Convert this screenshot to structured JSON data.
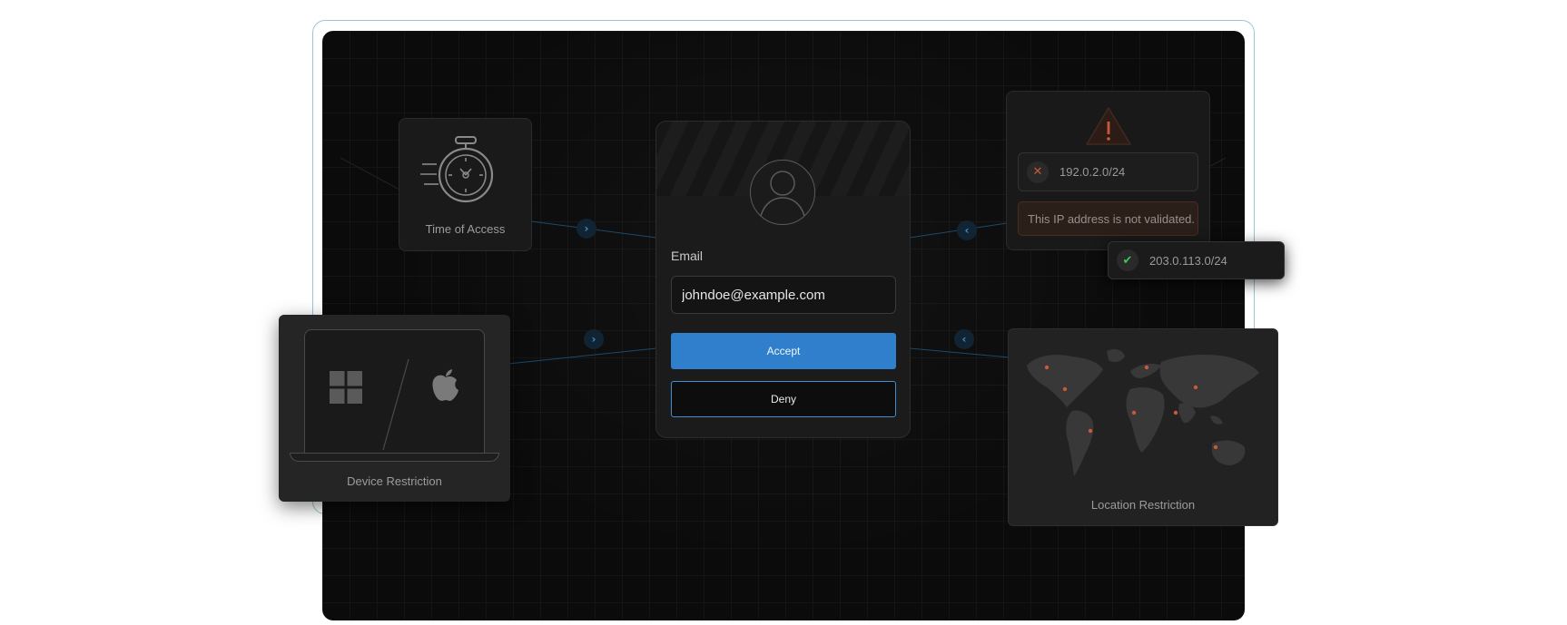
{
  "time_card": {
    "label": "Time of Access",
    "icon": "stopwatch-icon"
  },
  "device_card": {
    "label": "Device Restriction",
    "icons": [
      "windows-icon",
      "apple-icon"
    ]
  },
  "location_card": {
    "label": "Location Restriction",
    "icon": "world-map-icon"
  },
  "login": {
    "email_label": "Email",
    "email_value": "johndoe@example.com",
    "accept_label": "Accept",
    "deny_label": "Deny"
  },
  "ip_card": {
    "blocked_ip": "192.0.2.0/24",
    "error_message": "This IP address is not validated.",
    "allowed_ip": "203.0.113.0/24"
  },
  "colors": {
    "accent": "#2f7fcc",
    "error": "#c85a3a",
    "success": "#3ec65a",
    "background": "#0b0b0b"
  }
}
